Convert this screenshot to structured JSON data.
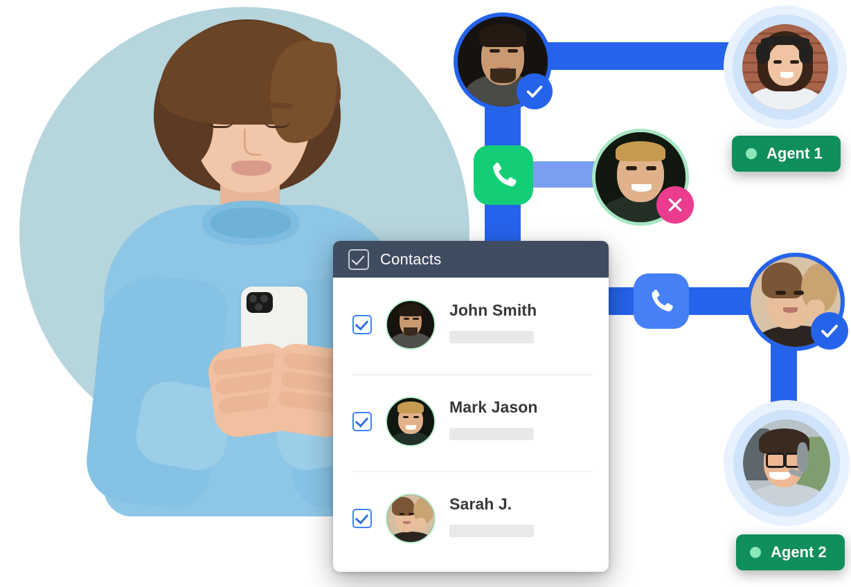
{
  "scene": {
    "title": "Contacts call routing illustration",
    "colors": {
      "hero_circle": "#b6d5dc",
      "connector_blue": "#2563eb",
      "connector_blue_light": "#7b9ff0",
      "phone_green": "#13ce77",
      "phone_blue": "#4580f7",
      "badge_check_blue": "#2563eb",
      "badge_cross_pink": "#ec3c8e",
      "agent_green": "#0f8f5b",
      "agent_dot_green": "#8ce8b8",
      "card_header": "#3f4c60",
      "card_body": "#ffffff",
      "checkbox_blue": "#3b82f6",
      "avatar_ring_green": "#b8f0cd",
      "avatar_ring_blue": "#2563eb",
      "avatar_halo_blue": "#cfe3fb",
      "placeholder_gray": "#e9e9eb"
    }
  },
  "hero": {
    "alt": "Smiling woman in light blue sweater holding a white smartphone"
  },
  "contacts_card": {
    "header": {
      "title": "Contacts",
      "checkbox_icon": "checkbox-checked-icon",
      "checked": true
    },
    "rows": [
      {
        "name": "John Smith",
        "checked": true,
        "avatar_alt": "Portrait of a bearded man",
        "subtitle_placeholder": ""
      },
      {
        "name": "Mark Jason",
        "checked": true,
        "avatar_alt": "Portrait of a smiling blond man",
        "subtitle_placeholder": ""
      },
      {
        "name": "Sarah J.",
        "checked": true,
        "avatar_alt": "Portrait of a woman with curly hair",
        "subtitle_placeholder": ""
      }
    ]
  },
  "nodes": {
    "caller_top": {
      "alt": "Man with dark beard",
      "status": "accepted",
      "status_icon": "check-circle-icon"
    },
    "caller_middle": {
      "alt": "Smiling blond man",
      "status": "declined",
      "status_icon": "close-circle-icon"
    },
    "contact_right": {
      "alt": "Woman with curly hair",
      "status": "accepted",
      "status_icon": "check-circle-icon"
    }
  },
  "phone_buttons": [
    {
      "label": "",
      "icon": "phone-handset-icon",
      "variant": "green"
    },
    {
      "label": "",
      "icon": "phone-handset-icon",
      "variant": "blue"
    }
  ],
  "agents": [
    {
      "label": "Agent 1",
      "status_dot": "online",
      "avatar_alt": "Female call center agent with headset"
    },
    {
      "label": "Agent 2",
      "status_dot": "online",
      "avatar_alt": "Male call center agent with glasses and headset"
    }
  ]
}
